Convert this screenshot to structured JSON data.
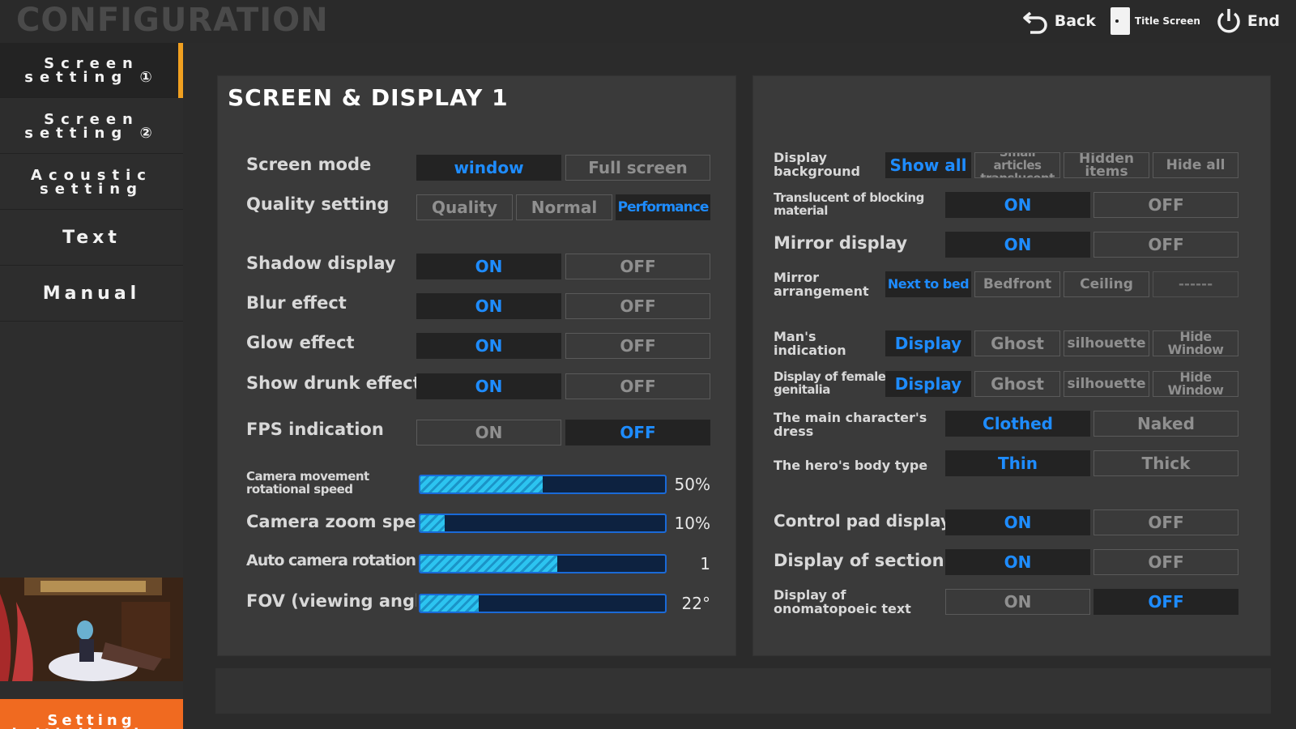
{
  "header": {
    "title": "CONFIGURATION",
    "back_label": "Back",
    "title_screen_label": "Title Screen",
    "end_label": "End"
  },
  "sidebar": {
    "items": [
      {
        "label": "Screen\nsetting ①",
        "active": true
      },
      {
        "label": "Screen\nsetting ②",
        "active": false
      },
      {
        "label": "Acoustic\nsetting",
        "active": false
      },
      {
        "label": "Text",
        "active": false
      },
      {
        "label": "Manual",
        "active": false
      }
    ],
    "init_label": "Setting\ninitialization"
  },
  "left_panel": {
    "title": "SCREEN & DISPLAY 1",
    "screen_mode": {
      "label": "Screen mode",
      "options": [
        "window",
        "Full screen"
      ],
      "selected": 0
    },
    "quality": {
      "label": "Quality setting",
      "options": [
        "Quality",
        "Normal",
        "Performance"
      ],
      "selected": 2
    },
    "shadow": {
      "label": "Shadow display",
      "options": [
        "ON",
        "OFF"
      ],
      "selected": 0
    },
    "blur": {
      "label": "Blur effect",
      "options": [
        "ON",
        "OFF"
      ],
      "selected": 0
    },
    "glow": {
      "label": "Glow effect",
      "options": [
        "ON",
        "OFF"
      ],
      "selected": 0
    },
    "drunk": {
      "label": "Show drunk effect",
      "options": [
        "ON",
        "OFF"
      ],
      "selected": 0
    },
    "fps": {
      "label": "FPS indication",
      "options": [
        "ON",
        "OFF"
      ],
      "selected": 1
    },
    "sliders": [
      {
        "label": "Camera movement rotational speed",
        "value_text": "50%",
        "fraction": 0.5
      },
      {
        "label": "Camera zoom speed",
        "value_text": "10%",
        "fraction": 0.1
      },
      {
        "label": "Auto camera rotation speed",
        "value_text": "1",
        "fraction": 0.56
      },
      {
        "label": "FOV (viewing angle)",
        "value_text": "22°",
        "fraction": 0.24
      }
    ]
  },
  "right_panel": {
    "display_background": {
      "label": "Display background",
      "options": [
        "Show all",
        "Small articles translucent",
        "Hidden items",
        "Hide all"
      ],
      "selected": 0
    },
    "translucent_blocking": {
      "label": "Translucent of blocking material",
      "options": [
        "ON",
        "OFF"
      ],
      "selected": 0
    },
    "mirror_display": {
      "label": "Mirror display",
      "options": [
        "ON",
        "OFF"
      ],
      "selected": 0
    },
    "mirror_arrangement": {
      "label": "Mirror arrangement",
      "options": [
        "Next to bed",
        "Bedfront",
        "Ceiling",
        "------"
      ],
      "selected": 0
    },
    "mans_indication": {
      "label": "Man's indication",
      "options": [
        "Display",
        "Ghost",
        "silhouette",
        "Hide Window"
      ],
      "selected": 0
    },
    "female_genitalia": {
      "label": "Display of female genitalia",
      "options": [
        "Display",
        "Ghost",
        "silhouette",
        "Hide Window"
      ],
      "selected": 0
    },
    "main_dress": {
      "label": "The main character's dress",
      "options": [
        "Clothed",
        "Naked"
      ],
      "selected": 0
    },
    "body_type": {
      "label": "The hero's body type",
      "options": [
        "Thin",
        "Thick"
      ],
      "selected": 0
    },
    "control_pad": {
      "label": "Control pad display",
      "options": [
        "ON",
        "OFF"
      ],
      "selected": 0
    },
    "section": {
      "label": "Display of section",
      "options": [
        "ON",
        "OFF"
      ],
      "selected": 0
    },
    "onomatopoeic": {
      "label": "Display of onomatopoeic text",
      "options": [
        "ON",
        "OFF"
      ],
      "selected": 1
    }
  },
  "colors": {
    "accent_blue": "#1e8cff",
    "active_tab": "#f0a020",
    "init_button": "#f06a20"
  },
  "icons": {
    "back": "undo-arrow-icon",
    "title_screen": "card-icon",
    "end": "power-icon"
  }
}
